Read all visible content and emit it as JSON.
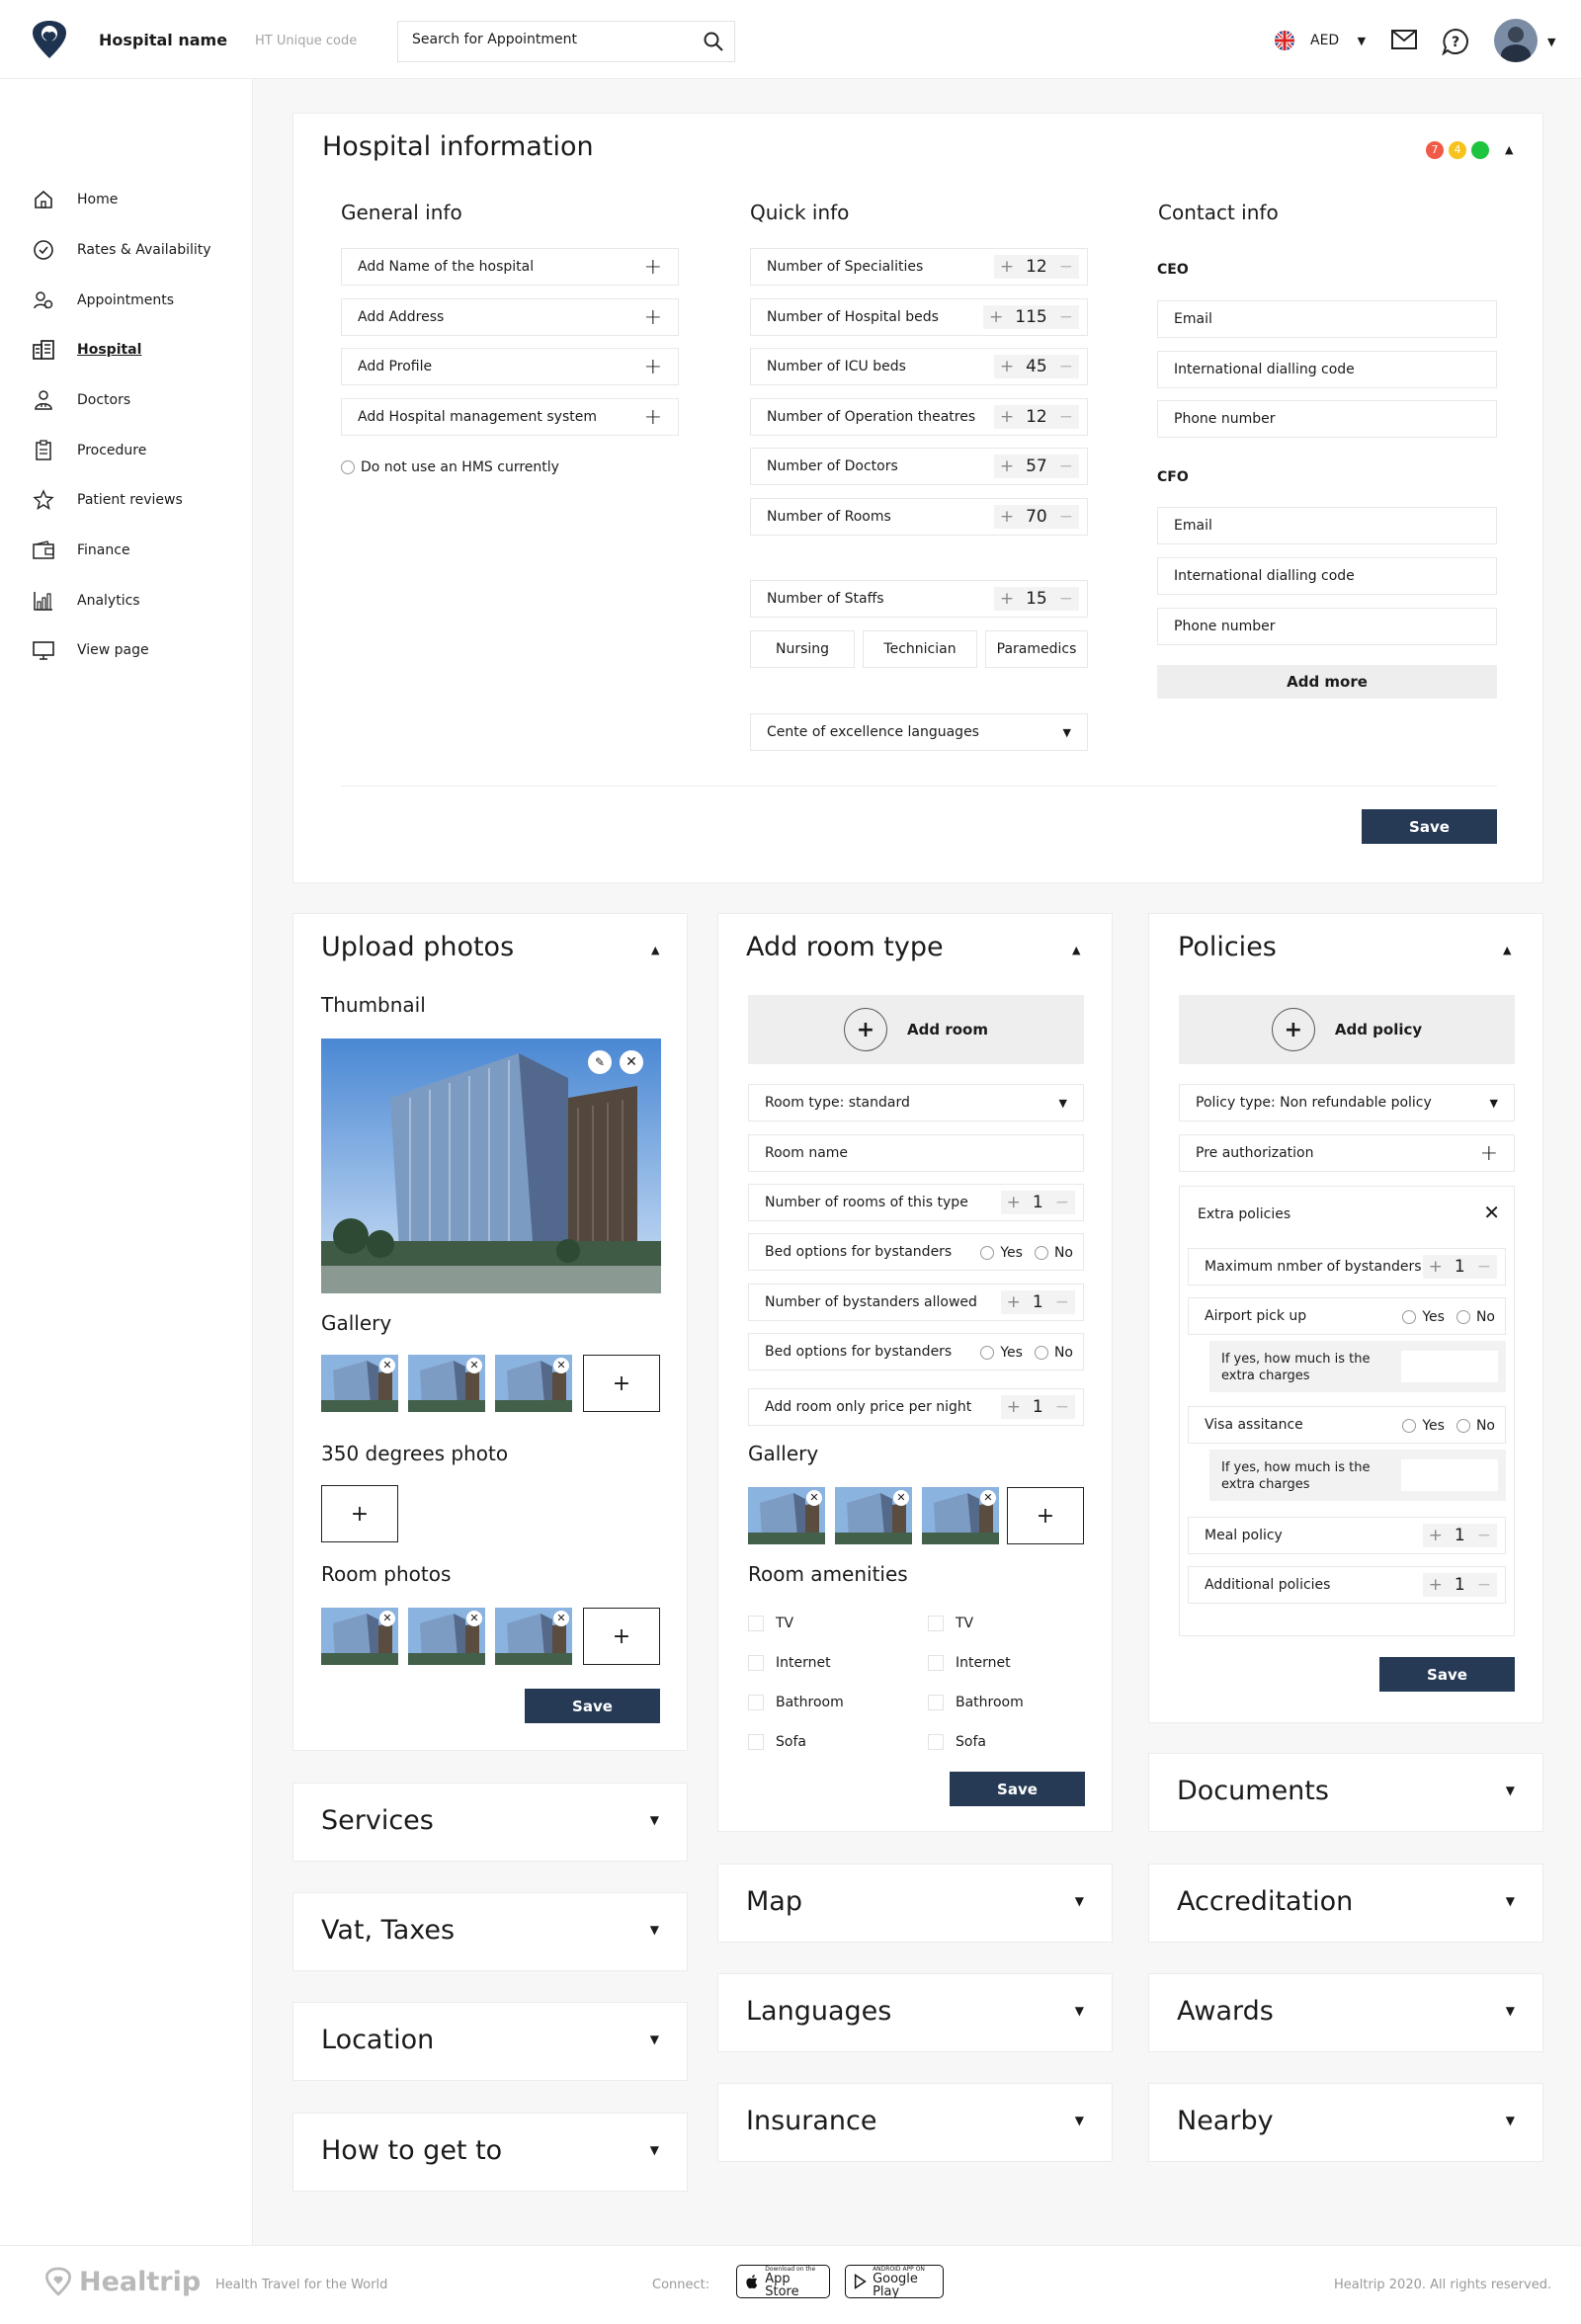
{
  "header": {
    "hospital_name": "Hospital name",
    "unique_code": "HT Unique code",
    "search_placeholder": "Search for Appointment",
    "currency": "AED"
  },
  "sidebar": {
    "items": [
      {
        "label": "Home",
        "icon": "home-icon"
      },
      {
        "label": "Rates & Availability",
        "icon": "check-circle-icon"
      },
      {
        "label": "Appointments",
        "icon": "users-icon"
      },
      {
        "label": "Hospital",
        "icon": "building-icon",
        "active": true
      },
      {
        "label": "Doctors",
        "icon": "doctor-icon"
      },
      {
        "label": "Procedure",
        "icon": "clipboard-icon"
      },
      {
        "label": "Patient reviews",
        "icon": "star-icon"
      },
      {
        "label": "Finance",
        "icon": "wallet-icon"
      },
      {
        "label": "Analytics",
        "icon": "chart-icon"
      },
      {
        "label": "View page",
        "icon": "monitor-icon"
      }
    ]
  },
  "hospital_info": {
    "title": "Hospital information",
    "status_dots": [
      {
        "label": "7",
        "color": "#f05a47"
      },
      {
        "label": "4",
        "color": "#f7c21b"
      },
      {
        "label": "",
        "color": "#1fc43e"
      }
    ],
    "general": {
      "title": "General info",
      "fields": [
        "Add Name of the hospital",
        "Add Address",
        "Add Profile",
        "Add Hospital management system"
      ],
      "no_hms_label": "Do not use an HMS currently"
    },
    "quick": {
      "title": "Quick info",
      "steppers": [
        {
          "label": "Number of Specialities",
          "value": "12"
        },
        {
          "label": "Number of Hospital beds",
          "value": "115"
        },
        {
          "label": "Number of ICU beds",
          "value": "45"
        },
        {
          "label": "Number of Operation theatres",
          "value": "12"
        },
        {
          "label": "Number of Doctors",
          "value": "57"
        },
        {
          "label": "Number of Rooms",
          "value": "70"
        }
      ],
      "staffs": {
        "label": "Number of Staffs",
        "value": "15"
      },
      "staff_types": [
        "Nursing",
        "Technician",
        "Paramedics"
      ],
      "languages_label": "Cente of excellence languages"
    },
    "contact": {
      "title": "Contact info",
      "ceo_label": "CEO",
      "cfo_label": "CFO",
      "ceo_fields": [
        "Email",
        "International dialling code",
        "Phone number"
      ],
      "cfo_fields": [
        "Email",
        "International dialling code",
        "Phone number"
      ],
      "add_more": "Add more"
    },
    "save": "Save"
  },
  "upload_photos": {
    "title": "Upload photos",
    "thumbnail": "Thumbnail",
    "gallery": "Gallery",
    "degrees": "350 degrees photo",
    "room_photos": "Room photos",
    "save": "Save"
  },
  "room_type": {
    "title": "Add room type",
    "add_room": "Add room",
    "room_type_select": "Room type: standard",
    "room_name": "Room name",
    "rooms_count": {
      "label": "Number of rooms of this type",
      "value": "1"
    },
    "bed_options_1": "Bed options for bystanders",
    "bystanders": {
      "label": "Number of bystanders allowed",
      "value": "1"
    },
    "bed_options_2": "Bed options for bystanders",
    "price": {
      "label": "Add room only price per night",
      "value": "1"
    },
    "yes": "Yes",
    "no": "No",
    "gallery": "Gallery",
    "amenities_title": "Room amenities",
    "amenities_left": [
      "TV",
      "Internet",
      "Bathroom",
      "Sofa"
    ],
    "amenities_right": [
      "TV",
      "Internet",
      "Bathroom",
      "Sofa"
    ],
    "save": "Save"
  },
  "policies": {
    "title": "Policies",
    "add_policy": "Add policy",
    "policy_type": "Policy type: Non refundable policy",
    "pre_auth": "Pre authorization",
    "extra": "Extra policies",
    "max_bystanders": {
      "label": "Maximum nmber of bystanders",
      "value": "1"
    },
    "airport": "Airport pick up",
    "extra_charges_1": "If yes, how much is the extra charges",
    "visa": "Visa assitance",
    "extra_charges_2": "If yes, how much is the extra charges",
    "meal": {
      "label": "Meal policy",
      "value": "1"
    },
    "additional": {
      "label": "Additional policies",
      "value": "1"
    },
    "yes": "Yes",
    "no": "No",
    "save": "Save"
  },
  "collapsed": {
    "services": "Services",
    "vat": "Vat, Taxes",
    "location": "Location",
    "how_to": "How to get to",
    "map": "Map",
    "languages": "Languages",
    "insurance": "Insurance",
    "documents": "Documents",
    "accreditation": "Accreditation",
    "awards": "Awards",
    "nearby": "Nearby"
  },
  "footer": {
    "brand": "Healtrip",
    "tagline": "Health Travel for the World",
    "connect": "Connect:",
    "app_store_small": "Download on the",
    "app_store": "App Store",
    "google_small": "ANDROID APP ON",
    "google": "Google Play",
    "copyright": "Healtrip 2020. All rights reserved."
  }
}
